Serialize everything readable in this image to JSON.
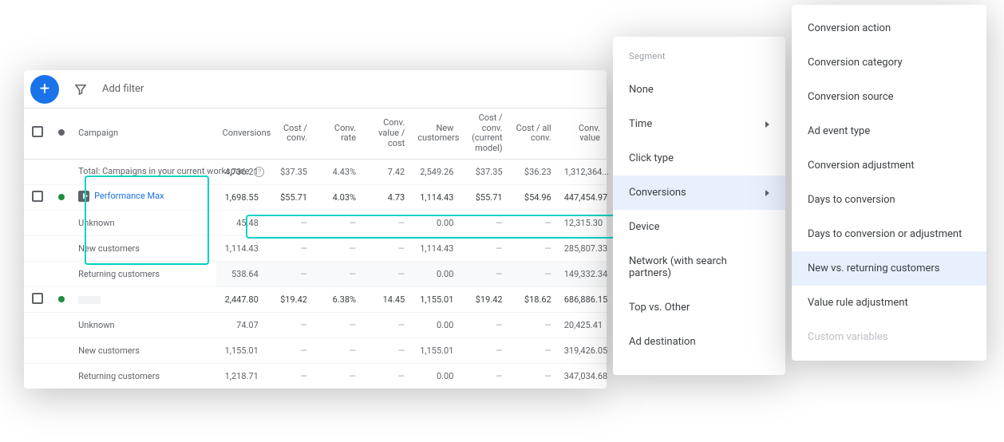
{
  "filterbar": {
    "add_filter": "Add filter"
  },
  "columns": {
    "campaign": "Campaign",
    "conversions": "Conversions",
    "cost_per_conv": "Cost / conv.",
    "conv_rate": "Conv. rate",
    "conv_value_per_cost": "Conv. value / cost",
    "new_customers": "New customers",
    "cost_per_conv_current_model": "Cost / conv. (current model)",
    "cost_all_conv": "Cost / all conv.",
    "conv_value": "Conv. value"
  },
  "total_row": {
    "label": "Total: Campaigns in your current workspace",
    "conversions": "4,736.21",
    "cost_per_conv": "$37.35",
    "conv_rate": "4.43%",
    "conv_value_per_cost": "7.42",
    "new_customers": "2,549.26",
    "cost_per_conv_current_model": "$37.35",
    "cost_all_conv": "$36.23",
    "conv_value": "1,312,364..."
  },
  "rows": [
    {
      "type": "campaign",
      "name": "Performance Max",
      "dot": "green",
      "conversions": "1,698.55",
      "cost_per_conv": "$55.71",
      "conv_rate": "4.03%",
      "conv_value_per_cost": "4.73",
      "new_customers": "1,114.43",
      "cost_per_conv_current_model": "$55.71",
      "cost_all_conv": "$54.96",
      "conv_value": "447,454.97"
    },
    {
      "type": "segment",
      "name": "Unknown",
      "conversions": "45.48",
      "cost_per_conv": "—",
      "conv_rate": "—",
      "conv_value_per_cost": "—",
      "new_customers": "0.00",
      "cost_per_conv_current_model": "—",
      "cost_all_conv": "—",
      "conv_value": "12,315.30"
    },
    {
      "type": "segment",
      "name": "New customers",
      "conversions": "1,114.43",
      "cost_per_conv": "—",
      "conv_rate": "—",
      "conv_value_per_cost": "—",
      "new_customers": "1,114.43",
      "cost_per_conv_current_model": "—",
      "cost_all_conv": "—",
      "conv_value": "285,807.33"
    },
    {
      "type": "segment",
      "name": "Returning customers",
      "shade": true,
      "conversions": "538.64",
      "cost_per_conv": "—",
      "conv_rate": "—",
      "conv_value_per_cost": "—",
      "new_customers": "0.00",
      "cost_per_conv_current_model": "—",
      "cost_all_conv": "—",
      "conv_value": "149,332.34"
    },
    {
      "type": "campaign",
      "name": "",
      "dot": "green",
      "truncated": true,
      "conversions": "2,447.80",
      "cost_per_conv": "$19.42",
      "conv_rate": "6.38%",
      "conv_value_per_cost": "14.45",
      "new_customers": "1,155.01",
      "cost_per_conv_current_model": "$19.42",
      "cost_all_conv": "$18.62",
      "conv_value": "686,886.15"
    },
    {
      "type": "segment",
      "name": "Unknown",
      "conversions": "74.07",
      "cost_per_conv": "—",
      "conv_rate": "—",
      "conv_value_per_cost": "—",
      "new_customers": "0.00",
      "cost_per_conv_current_model": "—",
      "cost_all_conv": "—",
      "conv_value": "20,425.41"
    },
    {
      "type": "segment",
      "name": "New customers",
      "conversions": "1,155.01",
      "cost_per_conv": "—",
      "conv_rate": "—",
      "conv_value_per_cost": "—",
      "new_customers": "1,155.01",
      "cost_per_conv_current_model": "—",
      "cost_all_conv": "—",
      "conv_value": "319,426.05"
    },
    {
      "type": "segment",
      "name": "Returning customers",
      "conversions": "1,218.71",
      "cost_per_conv": "—",
      "conv_rate": "—",
      "conv_value_per_cost": "—",
      "new_customers": "0.00",
      "cost_per_conv_current_model": "—",
      "cost_all_conv": "—",
      "conv_value": "347,034.68"
    }
  ],
  "segment_menu": {
    "title": "Segment",
    "items": [
      {
        "label": "None"
      },
      {
        "label": "Time",
        "submenu": true
      },
      {
        "label": "Click type"
      },
      {
        "label": "Conversions",
        "submenu": true,
        "hover": true
      },
      {
        "label": "Device"
      },
      {
        "label": "Network (with search partners)"
      },
      {
        "label": "Top vs. Other"
      },
      {
        "label": "Ad destination"
      }
    ]
  },
  "conversions_submenu": {
    "items": [
      {
        "label": "Conversion action"
      },
      {
        "label": "Conversion category"
      },
      {
        "label": "Conversion source"
      },
      {
        "label": "Ad event type"
      },
      {
        "label": "Conversion adjustment"
      },
      {
        "label": "Days to conversion"
      },
      {
        "label": "Days to conversion or adjustment"
      },
      {
        "label": "New vs. returning customers",
        "hover": true
      },
      {
        "label": "Value rule adjustment"
      },
      {
        "label": "Custom variables",
        "disabled": true
      }
    ]
  }
}
